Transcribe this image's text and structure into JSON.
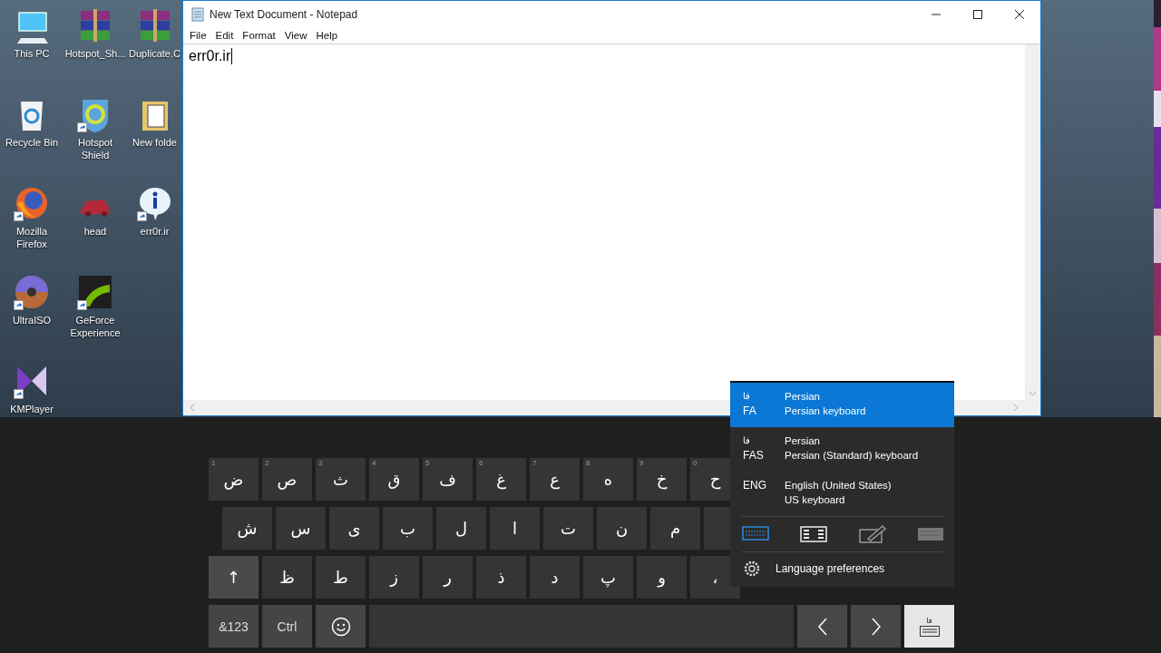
{
  "desktop": {
    "columns": [
      [
        {
          "label": "This PC",
          "kind": "computer",
          "shortcut": false
        },
        {
          "label": "Recycle Bin",
          "kind": "recycle",
          "shortcut": false
        },
        {
          "label": "Mozilla Firefox",
          "kind": "browser",
          "shortcut": true
        },
        {
          "label": "UltraISO",
          "kind": "disc",
          "shortcut": true
        },
        {
          "label": "KMPlayer",
          "kind": "player",
          "shortcut": true
        }
      ],
      [
        {
          "label": "Hotspot_Sh...",
          "kind": "archive",
          "shortcut": false
        },
        {
          "label": "Hotspot Shield",
          "kind": "shield",
          "shortcut": true
        },
        {
          "label": "head",
          "kind": "car",
          "shortcut": false
        },
        {
          "label": "GeForce Experience",
          "kind": "swoosh",
          "shortcut": true
        }
      ],
      [
        {
          "label": "Duplicate.C",
          "kind": "archive",
          "shortcut": false
        },
        {
          "label": "New folde",
          "kind": "folder",
          "shortcut": false
        },
        {
          "label": "err0r.ir",
          "kind": "info",
          "shortcut": true
        }
      ]
    ]
  },
  "notepad": {
    "title": "New Text Document - Notepad",
    "menu": [
      "File",
      "Edit",
      "Format",
      "View",
      "Help"
    ],
    "text": "err0r.ir"
  },
  "keyboard": {
    "rows": [
      [
        {
          "kind": "char",
          "label": "ض",
          "hint": "1"
        },
        {
          "kind": "char",
          "label": "ص",
          "hint": "2"
        },
        {
          "kind": "char",
          "label": "ث",
          "hint": "3"
        },
        {
          "kind": "char",
          "label": "ق",
          "hint": "4"
        },
        {
          "kind": "char",
          "label": "ف",
          "hint": "5"
        },
        {
          "kind": "char",
          "label": "غ",
          "hint": "6"
        },
        {
          "kind": "char",
          "label": "ع",
          "hint": "7"
        },
        {
          "kind": "char",
          "label": "ه",
          "hint": "8"
        },
        {
          "kind": "char",
          "label": "خ",
          "hint": "9"
        },
        {
          "kind": "char",
          "label": "ح",
          "hint": "0"
        }
      ],
      [
        {
          "kind": "char",
          "label": "ش"
        },
        {
          "kind": "char",
          "label": "س"
        },
        {
          "kind": "char",
          "label": "ی"
        },
        {
          "kind": "char",
          "label": "ب"
        },
        {
          "kind": "char",
          "label": "ل"
        },
        {
          "kind": "char",
          "label": "ا"
        },
        {
          "kind": "char",
          "label": "ت"
        },
        {
          "kind": "char",
          "label": "ن"
        },
        {
          "kind": "char",
          "label": "م"
        }
      ],
      [
        {
          "kind": "shift",
          "label": "↑"
        },
        {
          "kind": "char",
          "label": "ظ"
        },
        {
          "kind": "char",
          "label": "ط"
        },
        {
          "kind": "char",
          "label": "ز"
        },
        {
          "kind": "char",
          "label": "ر"
        },
        {
          "kind": "char",
          "label": "ذ"
        },
        {
          "kind": "char",
          "label": "د"
        },
        {
          "kind": "char",
          "label": "پ"
        },
        {
          "kind": "char",
          "label": "و"
        },
        {
          "kind": "char",
          "label": "،"
        }
      ],
      [
        {
          "kind": "function",
          "label": "&123"
        },
        {
          "kind": "function",
          "label": "Ctrl"
        },
        {
          "kind": "emoji"
        },
        {
          "kind": "space"
        },
        {
          "kind": "prev"
        },
        {
          "kind": "next"
        },
        {
          "kind": "switch",
          "label": "فا"
        }
      ]
    ]
  },
  "language_menu": {
    "languages": [
      {
        "glyph": "فا",
        "code": "FA",
        "name": "Persian",
        "layout": "Persian keyboard",
        "selected": true
      },
      {
        "glyph": "فا",
        "code": "FAS",
        "name": "Persian",
        "layout": "Persian (Standard) keyboard",
        "selected": false
      },
      {
        "code": "ENG",
        "name": "English (United States)",
        "layout": "US keyboard",
        "selected": false
      }
    ],
    "modes": [
      {
        "kind": "standard",
        "selected": true
      },
      {
        "kind": "split",
        "selected": false
      },
      {
        "kind": "handwriting",
        "selected": false
      },
      {
        "kind": "full",
        "selected": false
      }
    ],
    "preferences": "Language preferences"
  }
}
